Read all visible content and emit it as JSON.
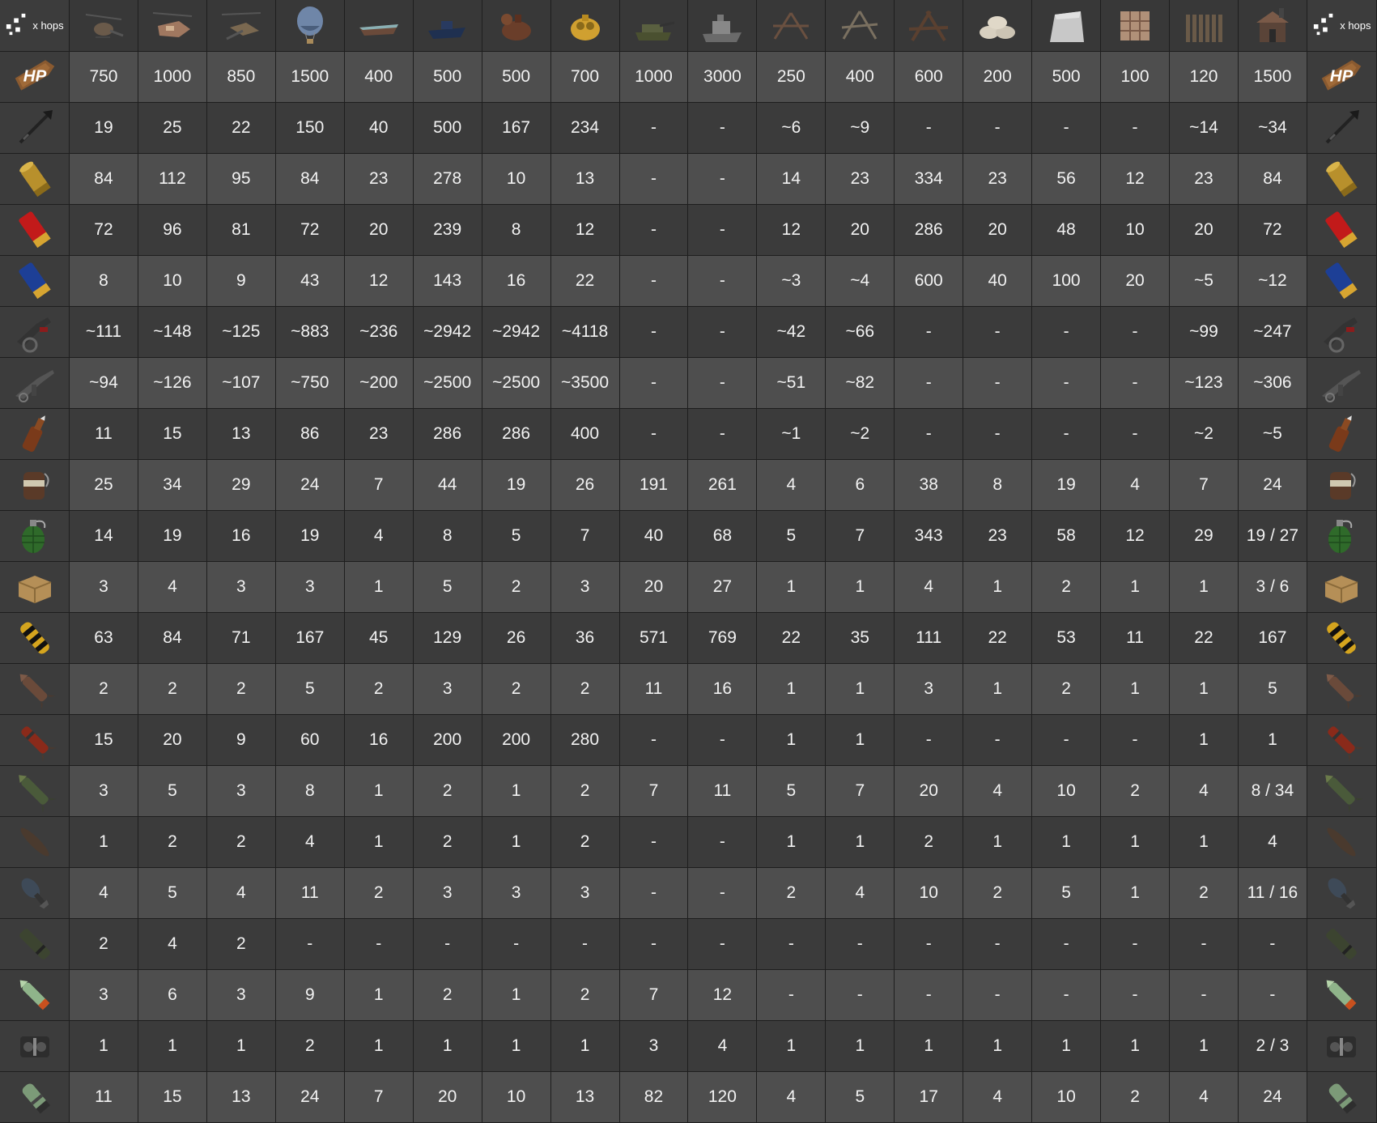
{
  "labels": {
    "hops": "x hops",
    "hp": "HP"
  },
  "colors": {
    "hp_row_bg": "#4e4e4e",
    "alt_row_bg": "#3b3b3b",
    "text": "#f2f2f2"
  },
  "target_icons": [
    "minicopter-icon",
    "scrap-heli-icon",
    "attack-heli-icon",
    "hot-air-balloon-icon",
    "rowboat-icon",
    "rhib-icon",
    "submarine-icon",
    "duo-sub-icon",
    "bradley-icon",
    "patrol-tank-icon",
    "wood-spike-barricade-icon",
    "stone-spike-barricade-icon",
    "metal-barricade-icon",
    "sandbag-barricade-icon",
    "concrete-barricade-icon",
    "wood-crate-barricade-icon",
    "wooden-fence-icon",
    "shack-icon"
  ],
  "hp_values": [
    "750",
    "1000",
    "850",
    "1500",
    "400",
    "500",
    "500",
    "700",
    "1000",
    "3000",
    "250",
    "400",
    "600",
    "200",
    "500",
    "100",
    "120",
    "1500"
  ],
  "rows": [
    {
      "icon": "spear-icon",
      "cells": [
        "19",
        "25",
        "22",
        "150",
        "40",
        "500",
        "167",
        "234",
        "-",
        "-",
        "~6",
        "~9",
        "-",
        "-",
        "-",
        "-",
        "~14",
        "~34"
      ]
    },
    {
      "icon": "pistol-ammo-icon",
      "cells": [
        "84",
        "112",
        "95",
        "84",
        "23",
        "278",
        "10",
        "13",
        "-",
        "-",
        "14",
        "23",
        "334",
        "23",
        "56",
        "12",
        "23",
        "84"
      ]
    },
    {
      "icon": "shotgun-shell-red-icon",
      "cells": [
        "72",
        "96",
        "81",
        "72",
        "20",
        "239",
        "8",
        "12",
        "-",
        "-",
        "12",
        "20",
        "286",
        "20",
        "48",
        "10",
        "20",
        "72"
      ]
    },
    {
      "icon": "shotgun-shell-blue-icon",
      "cells": [
        "8",
        "10",
        "9",
        "43",
        "12",
        "143",
        "16",
        "22",
        "-",
        "-",
        "~3",
        "~4",
        "600",
        "40",
        "100",
        "20",
        "~5",
        "~12"
      ]
    },
    {
      "icon": "flamethrower-icon",
      "cells": [
        "~111",
        "~148",
        "~125",
        "~883",
        "~236",
        "~2942",
        "~2942",
        "~4118",
        "-",
        "-",
        "~42",
        "~66",
        "-",
        "-",
        "-",
        "-",
        "~99",
        "~247"
      ]
    },
    {
      "icon": "flame-rifle-icon",
      "cells": [
        "~94",
        "~126",
        "~107",
        "~750",
        "~200",
        "~2500",
        "~2500",
        "~3500",
        "-",
        "-",
        "~51",
        "~82",
        "-",
        "-",
        "-",
        "-",
        "~123",
        "~306"
      ]
    },
    {
      "icon": "molotov-icon",
      "cells": [
        "11",
        "15",
        "13",
        "86",
        "23",
        "286",
        "286",
        "400",
        "-",
        "-",
        "~1",
        "~2",
        "-",
        "-",
        "-",
        "-",
        "~2",
        "~5"
      ]
    },
    {
      "icon": "beancan-grenade-icon",
      "cells": [
        "25",
        "34",
        "29",
        "24",
        "7",
        "44",
        "19",
        "26",
        "191",
        "261",
        "4",
        "6",
        "38",
        "8",
        "19",
        "4",
        "7",
        "24"
      ]
    },
    {
      "icon": "f1-grenade-icon",
      "cells": [
        "14",
        "19",
        "16",
        "19",
        "4",
        "8",
        "5",
        "7",
        "40",
        "68",
        "5",
        "7",
        "343",
        "23",
        "58",
        "12",
        "29",
        "19 / 27"
      ]
    },
    {
      "icon": "satchel-charge-icon",
      "cells": [
        "3",
        "4",
        "3",
        "3",
        "1",
        "5",
        "2",
        "3",
        "20",
        "27",
        "1",
        "1",
        "4",
        "1",
        "2",
        "1",
        "1",
        "3 / 6"
      ]
    },
    {
      "icon": "explosive-ammo-icon",
      "cells": [
        "63",
        "84",
        "71",
        "167",
        "45",
        "129",
        "26",
        "36",
        "571",
        "769",
        "22",
        "35",
        "111",
        "22",
        "53",
        "11",
        "22",
        "167"
      ]
    },
    {
      "icon": "rocket-icon",
      "cells": [
        "2",
        "2",
        "2",
        "5",
        "2",
        "3",
        "2",
        "2",
        "11",
        "16",
        "1",
        "1",
        "3",
        "1",
        "2",
        "1",
        "1",
        "5"
      ]
    },
    {
      "icon": "incendiary-rocket-icon",
      "cells": [
        "15",
        "20",
        "9",
        "60",
        "16",
        "200",
        "200",
        "280",
        "-",
        "-",
        "1",
        "1",
        "-",
        "-",
        "-",
        "-",
        "1",
        "1"
      ]
    },
    {
      "icon": "hv-rocket-icon",
      "cells": [
        "3",
        "5",
        "3",
        "8",
        "1",
        "2",
        "1",
        "2",
        "7",
        "11",
        "5",
        "7",
        "20",
        "4",
        "10",
        "2",
        "4",
        "8 / 34"
      ]
    },
    {
      "icon": "torpedo-icon",
      "cells": [
        "1",
        "2",
        "2",
        "4",
        "1",
        "2",
        "1",
        "2",
        "-",
        "-",
        "1",
        "1",
        "2",
        "1",
        "1",
        "1",
        "1",
        "4"
      ]
    },
    {
      "icon": "mortar-shell-icon",
      "cells": [
        "4",
        "5",
        "4",
        "11",
        "2",
        "3",
        "3",
        "3",
        "-",
        "-",
        "2",
        "4",
        "10",
        "2",
        "5",
        "1",
        "2",
        "11 / 16"
      ]
    },
    {
      "icon": "sam-missile-icon",
      "cells": [
        "2",
        "4",
        "2",
        "-",
        "-",
        "-",
        "-",
        "-",
        "-",
        "-",
        "-",
        "-",
        "-",
        "-",
        "-",
        "-",
        "-",
        "-"
      ]
    },
    {
      "icon": "hv-missile-icon",
      "cells": [
        "3",
        "6",
        "3",
        "9",
        "1",
        "2",
        "1",
        "2",
        "7",
        "12",
        "-",
        "-",
        "-",
        "-",
        "-",
        "-",
        "-",
        "-"
      ]
    },
    {
      "icon": "c4-icon",
      "cells": [
        "1",
        "1",
        "1",
        "2",
        "1",
        "1",
        "1",
        "1",
        "3",
        "4",
        "1",
        "1",
        "1",
        "1",
        "1",
        "1",
        "1",
        "2 / 3"
      ]
    },
    {
      "icon": "grenade-launcher-round-icon",
      "cells": [
        "11",
        "15",
        "13",
        "24",
        "7",
        "20",
        "10",
        "13",
        "82",
        "120",
        "4",
        "5",
        "17",
        "4",
        "10",
        "2",
        "4",
        "24"
      ]
    }
  ]
}
